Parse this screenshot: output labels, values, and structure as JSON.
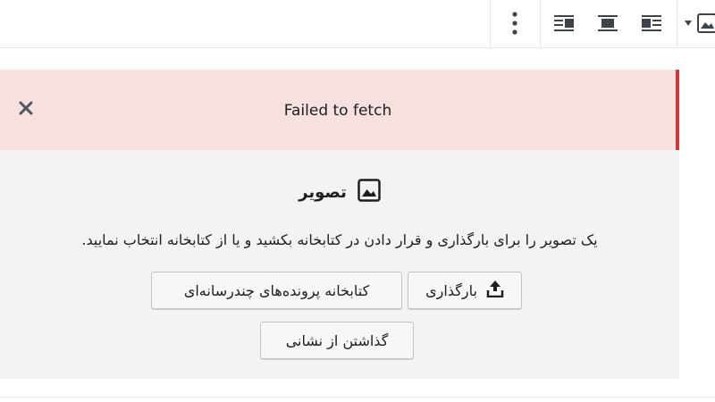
{
  "toolbar": {
    "buttons": [
      {
        "icon": "image-icon",
        "label": ""
      },
      {
        "icon": "dropdown-arrow-icon",
        "label": ""
      },
      {
        "icon": "align-right-icon",
        "label": ""
      },
      {
        "icon": "align-center-icon",
        "label": ""
      },
      {
        "icon": "align-left-icon",
        "label": ""
      },
      {
        "icon": "more-options-icon",
        "label": ""
      }
    ]
  },
  "notice": {
    "message": "Failed to fetch",
    "close_icon": "close-icon",
    "accent_color": "#d63638",
    "background_color": "#f6e0e0"
  },
  "placeholder": {
    "title": "تصویر",
    "icon": "image-icon",
    "instructions": "یک تصویر را برای بارگذاری و قرار دادن در کتابخانه بکشید و یا از کتابخانه انتخاب نمایید.",
    "upload_label": "بارگذاری",
    "upload_icon": "upload-icon",
    "media_library_label": "کتابخانه پرونده‌های چندرسانه‌ای",
    "insert_from_url_label": "گذاشتن از نشانی"
  }
}
